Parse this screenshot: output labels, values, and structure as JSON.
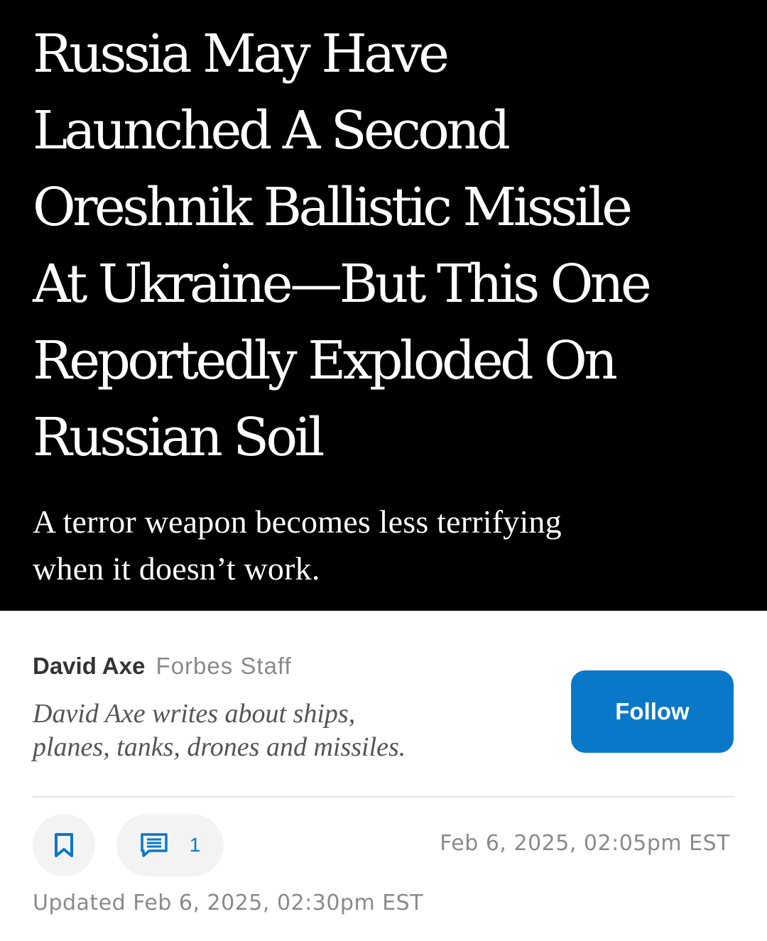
{
  "article": {
    "headline_lines": [
      "Russia May Have",
      "Launched A Second",
      "Oreshnik Ballistic Missile",
      "At Ukraine—But This One",
      "Reportedly Exploded On",
      "Russian Soil"
    ],
    "dek_lines": [
      "A terror weapon becomes less terrifying",
      "when it doesn’t work."
    ]
  },
  "author": {
    "name": "David Axe",
    "role": "Forbes Staff",
    "bio_lines": [
      "David Axe writes about ships,",
      "planes, tanks, drones and missiles."
    ],
    "follow_label": "Follow"
  },
  "actions": {
    "bookmark_icon": "bookmark-icon",
    "comment_icon": "comment-icon",
    "comment_count": "1"
  },
  "dates": {
    "published": "Feb 6, 2025, 02:05pm EST",
    "updated": "Updated Feb 6, 2025, 02:30pm EST"
  },
  "colors": {
    "hero_background": "#000000",
    "accent_blue": "#0a78c8",
    "meta_gray": "#8a8a8a"
  }
}
